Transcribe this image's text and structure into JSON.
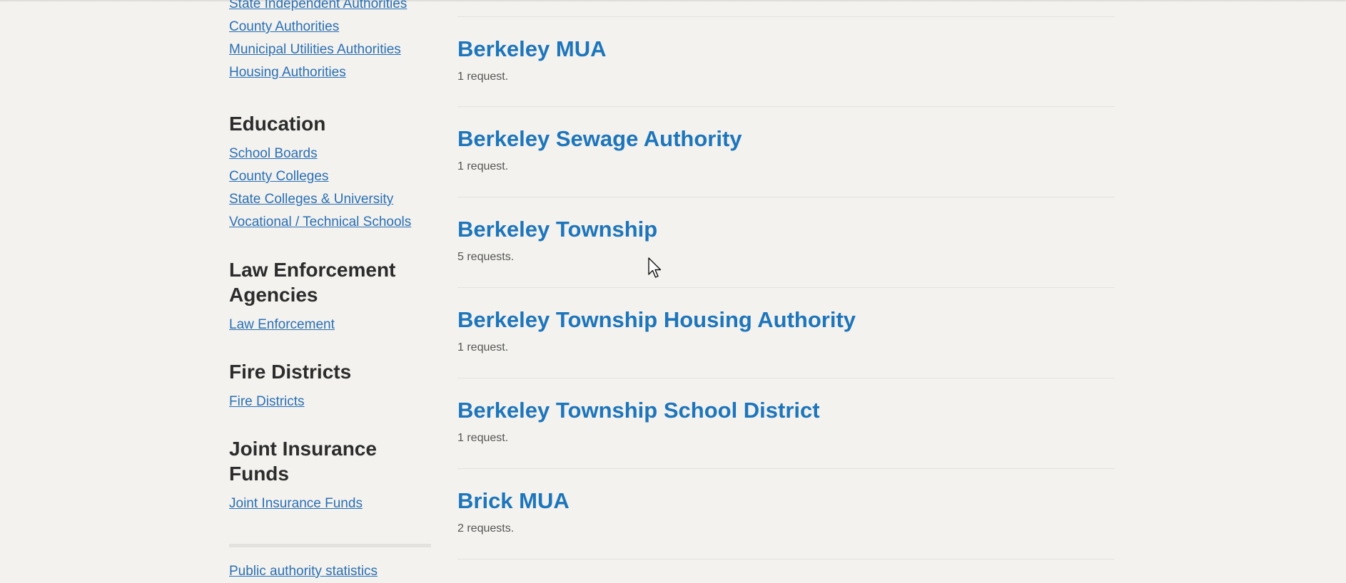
{
  "sidebar": {
    "top_links": [
      "State Independent Authorities",
      "County Authorities",
      "Municipal Utilities Authorities",
      "Housing Authorities"
    ],
    "education": {
      "heading": "Education",
      "links": [
        "School Boards",
        "County Colleges",
        "State Colleges & University",
        "Vocational / Technical Schools"
      ]
    },
    "law": {
      "heading": "Law Enforcement Agencies",
      "links": [
        "Law Enforcement"
      ]
    },
    "fire": {
      "heading": "Fire Districts",
      "links": [
        "Fire Districts"
      ]
    },
    "jif": {
      "heading": "Joint Insurance Funds",
      "links": [
        "Joint Insurance Funds"
      ]
    },
    "stats_link": "Public authority statistics"
  },
  "authorities": [
    {
      "name": "Berkeley MUA",
      "count": "1 request."
    },
    {
      "name": "Berkeley Sewage Authority",
      "count": "1 request."
    },
    {
      "name": "Berkeley Township",
      "count": "5 requests."
    },
    {
      "name": "Berkeley Township Housing Authority",
      "count": "1 request."
    },
    {
      "name": "Berkeley Township School District",
      "count": "1 request."
    },
    {
      "name": "Brick MUA",
      "count": "2 requests."
    }
  ]
}
